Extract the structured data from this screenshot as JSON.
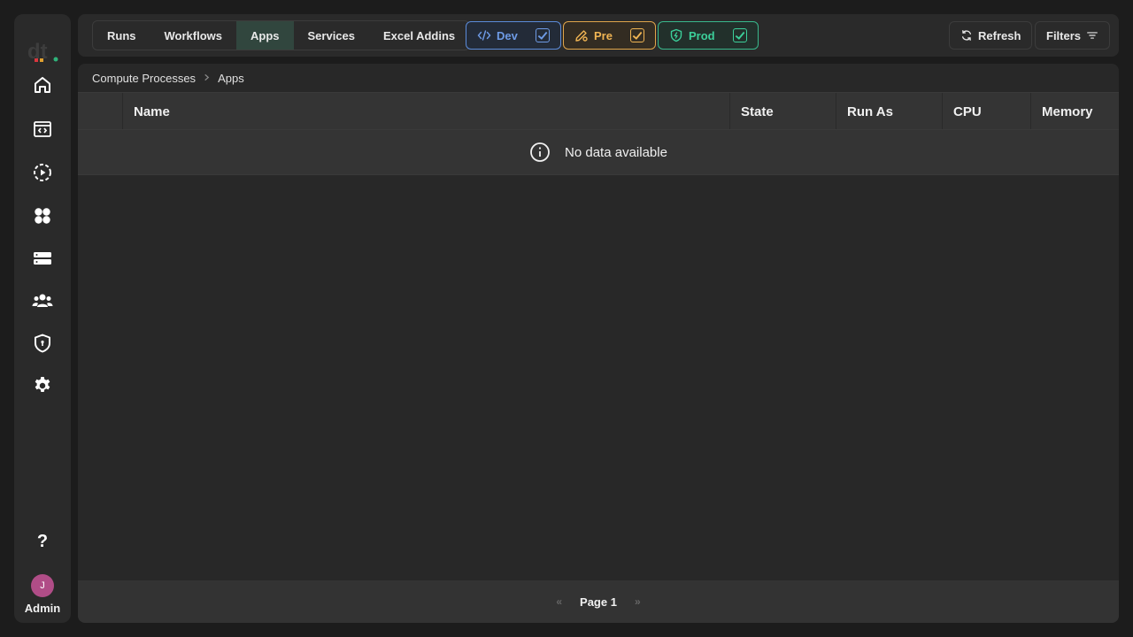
{
  "sidebar": {
    "logo": "dt.",
    "items": [
      {
        "icon": "home-icon"
      },
      {
        "icon": "code-window-icon"
      },
      {
        "icon": "run-process-icon"
      },
      {
        "icon": "apps-icon"
      },
      {
        "icon": "server-icon"
      },
      {
        "icon": "users-icon"
      },
      {
        "icon": "shield-icon"
      },
      {
        "icon": "gear-icon"
      }
    ],
    "help": "?",
    "user_initial": "J",
    "user_label": "Admin"
  },
  "header": {
    "tabs": [
      {
        "label": "Runs"
      },
      {
        "label": "Workflows"
      },
      {
        "label": "Apps"
      },
      {
        "label": "Services"
      },
      {
        "label": "Excel Addins"
      }
    ],
    "active_tab": "Apps",
    "environments": [
      {
        "label": "Dev",
        "color": "#6e9be6",
        "checked": true
      },
      {
        "label": "Pre",
        "color": "#f0b453",
        "checked": true
      },
      {
        "label": "Prod",
        "color": "#3ccf9a",
        "checked": true
      }
    ],
    "refresh_label": "Refresh",
    "filters_label": "Filters"
  },
  "breadcrumb": [
    "Compute Processes",
    "Apps"
  ],
  "table": {
    "columns": [
      "",
      "Name",
      "State",
      "Run As",
      "CPU",
      "Memory"
    ],
    "empty_message": "No data available"
  },
  "pagination": {
    "label": "Page 1",
    "prev": "«",
    "next": "»"
  },
  "colors": {
    "accent_active_tab": "#31463e",
    "avatar": "#b04d87"
  }
}
